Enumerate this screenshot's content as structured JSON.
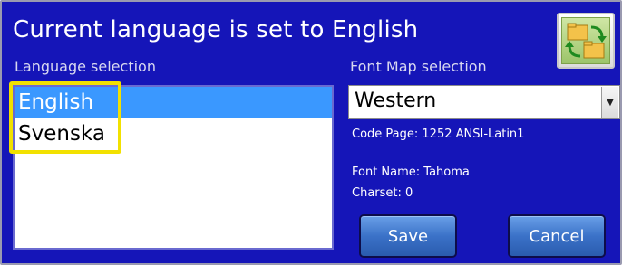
{
  "header": {
    "title": "Current language is set to English"
  },
  "language_selection": {
    "label": "Language selection",
    "items": [
      {
        "label": "English",
        "selected": true
      },
      {
        "label": "Svenska",
        "selected": false
      }
    ]
  },
  "font_map": {
    "label": "Font Map selection",
    "selected": "Western",
    "code_page": "Code Page: 1252 ANSI-Latin1",
    "font_name": "Font Name: Tahoma",
    "charset": "Charset: 0"
  },
  "buttons": {
    "save": "Save",
    "cancel": "Cancel"
  },
  "icons": {
    "app_icon": "language-swap-icon",
    "dropdown": "chevron-down-icon"
  },
  "colors": {
    "panel_background": "#1515b8",
    "selection": "#3a98ff",
    "highlight": "#f2e100",
    "button": "#3b72c8"
  }
}
